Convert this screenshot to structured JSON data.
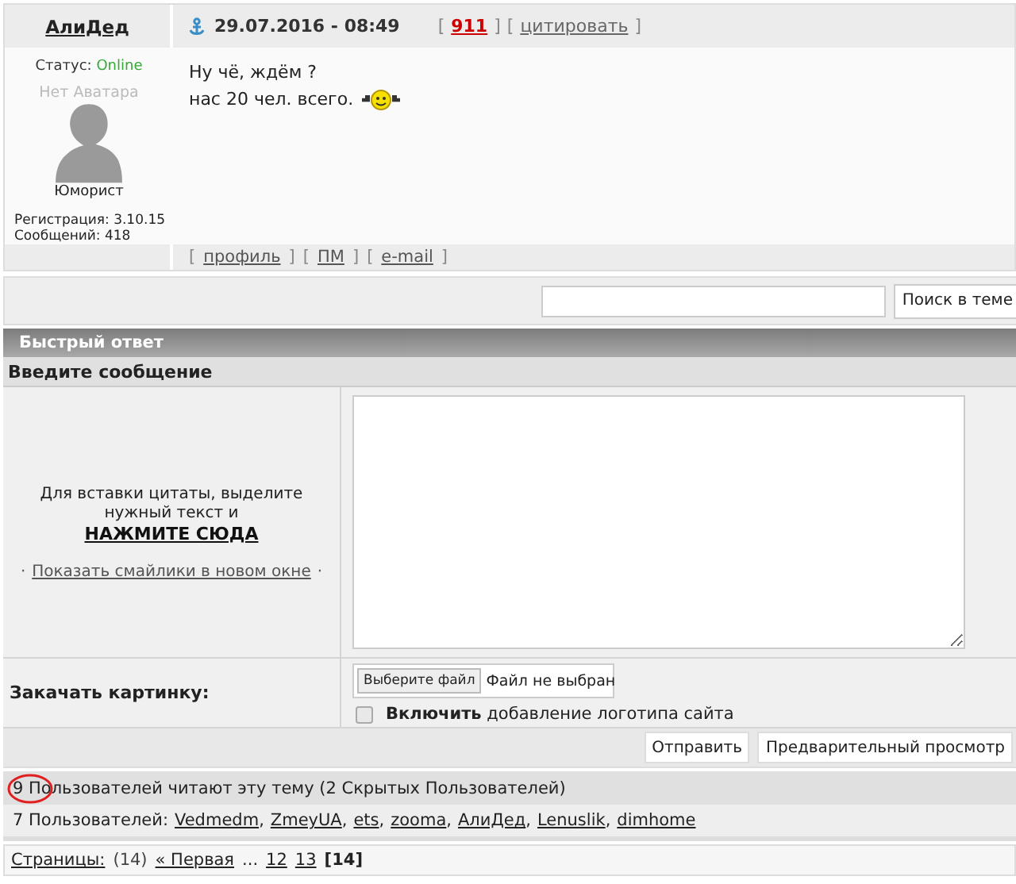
{
  "post": {
    "author": "АлиДед",
    "date": "29.07.2016 - 08:49",
    "bracket_open": "[",
    "bracket_close": "]",
    "post_number": "911",
    "quote_link": "цитировать",
    "status_label": "Статус:",
    "status": "Online",
    "avatar_caption": "Нет Аватара",
    "rank": "Юморист",
    "registration": "Регистрация: 3.10.15",
    "messages_count": "Сообщений: 418",
    "message_lines": [
      "Ну чё, ждём ?",
      "нас 20 чел. всего."
    ],
    "footer_links": [
      "профиль",
      "ПМ",
      "e-mail"
    ]
  },
  "search": {
    "button": "Поиск в теме"
  },
  "quick_reply": {
    "title": "Быстрый ответ",
    "section": "Введите сообщение",
    "hint": "Для вставки цитаты, выделите нужный текст и",
    "quote_link": "НАЖМИТЕ СЮДА",
    "smilies_mark": "·",
    "smilies_link": "Показать смайлики в новом окне",
    "upload_label": "Закачать картинку:",
    "file_button": "Выберите файл",
    "file_status": "Файл не выбран",
    "logo_option": {
      "text": "**Включить** добавление логотипа сайта",
      "checked": false
    },
    "buttons": [
      "Отправить",
      "Предварительный просмотр"
    ]
  },
  "readers": {
    "summary": "9 Пользователей читают эту тему (2 Скрытых Пользователей)",
    "members_label": "7 Пользователей:",
    "separator": ",",
    "members": [
      "Vedmedm",
      "ZmeyUA",
      "ets",
      "zooma",
      "АлиДед",
      "Lenuslik",
      "dimhome"
    ]
  },
  "pagination": {
    "label": "Страницы:",
    "count": "(14)",
    "first": "« Первая",
    "ellipsis": "...",
    "pages": [
      {
        "label": "12",
        "selected": false
      },
      {
        "label": "13",
        "selected": false
      },
      {
        "label": "[14]",
        "selected": true
      }
    ]
  }
}
